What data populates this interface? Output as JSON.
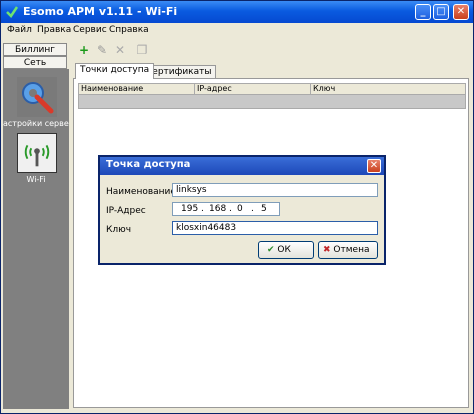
{
  "window": {
    "title": "Esomo APM v1.11 - Wi-Fi",
    "controls": {
      "minimize": "_",
      "maximize": "□",
      "close": "✕"
    }
  },
  "menu": [
    "Файл",
    "Правка",
    "Сервис",
    "Справка"
  ],
  "sidebar": {
    "billing": "Биллинг",
    "network": "Сеть",
    "items": [
      {
        "label": "астройки сервер",
        "icon": "wrench-gear-icon"
      },
      {
        "label": "Wi-Fi",
        "icon": "wifi-icon"
      }
    ]
  },
  "toolbar": {
    "add": "add-icon",
    "edit": "edit-icon",
    "delete": "delete-icon",
    "copy": "copy-icon"
  },
  "tabs": [
    "Точки доступа",
    "Сертификаты"
  ],
  "grid": {
    "columns": [
      "Наименование",
      "IP-адрес",
      "Ключ"
    ]
  },
  "dialog": {
    "title": "Точка доступа",
    "name_label": "Наименование",
    "name_value": "linksys",
    "ip_label": "IP-Адрес",
    "ip": [
      "195",
      "168",
      "0",
      "5"
    ],
    "key_label": "Ключ",
    "key_value": "klosxin46483",
    "ok": "ОК",
    "cancel": "Отмена"
  },
  "colors": {
    "title_blue": "#0a5be0",
    "close_red": "#c9401d",
    "ok_green": "#2a8a2a",
    "cancel_red": "#c0282b"
  }
}
